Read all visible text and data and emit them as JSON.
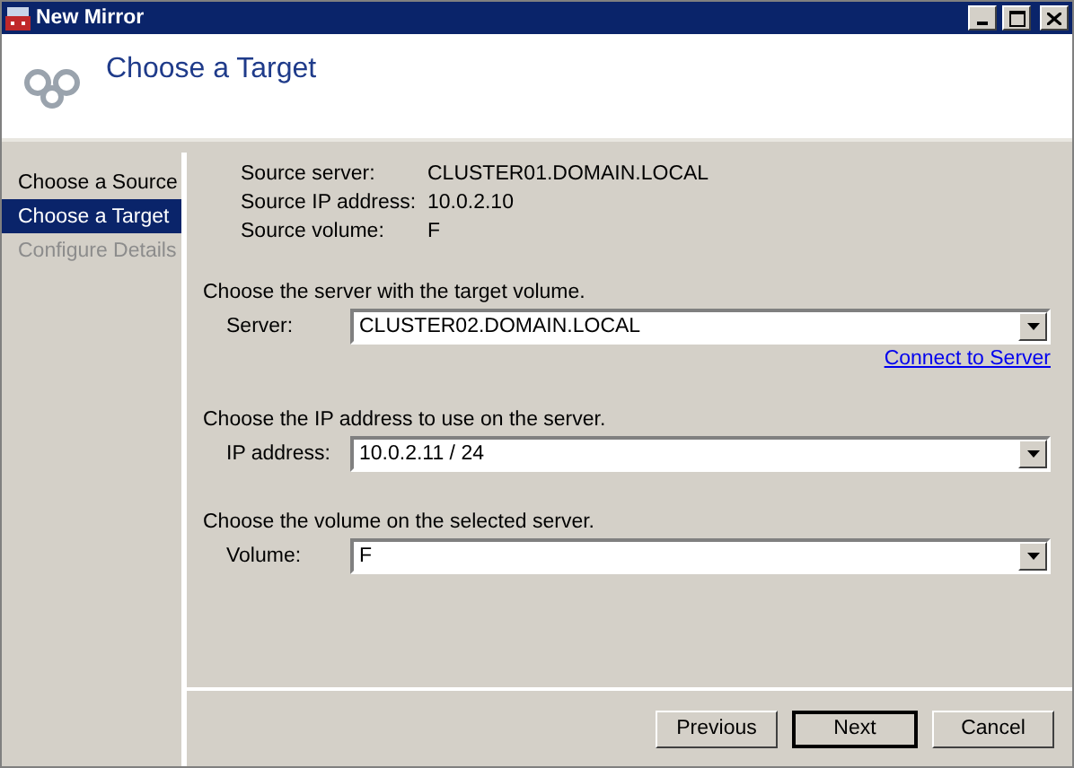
{
  "window": {
    "title": "New Mirror"
  },
  "header": {
    "title": "Choose a Target"
  },
  "steps": [
    {
      "label": "Choose a Source",
      "selected": false,
      "disabled": false
    },
    {
      "label": "Choose a Target",
      "selected": true,
      "disabled": false
    },
    {
      "label": "Configure Details",
      "selected": false,
      "disabled": true
    }
  ],
  "source_info": [
    {
      "label": "Source server:",
      "value": "CLUSTER01.DOMAIN.LOCAL"
    },
    {
      "label": "Source IP address:",
      "value": "10.0.2.10"
    },
    {
      "label": "Source volume:",
      "value": "F"
    }
  ],
  "sections": [
    {
      "prompt": "Choose the server with the target volume.",
      "label": "Server:",
      "value": "CLUSTER02.DOMAIN.LOCAL",
      "link": "Connect to Server"
    },
    {
      "prompt": "Choose the IP address to use on the server.",
      "label": "IP address:",
      "value": "10.0.2.11 / 24"
    },
    {
      "prompt": "Choose the volume on the selected server.",
      "label": "Volume:",
      "value": "F"
    }
  ],
  "buttons": [
    {
      "label": "Previous",
      "default": false
    },
    {
      "label": "Next",
      "default": true
    },
    {
      "label": "Cancel",
      "default": false
    }
  ]
}
